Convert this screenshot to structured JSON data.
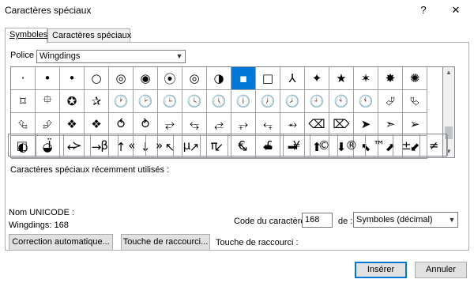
{
  "window": {
    "title": "Caractères spéciaux",
    "help_label": "?",
    "close_label": "✕"
  },
  "tabs": [
    {
      "label": "Symboles",
      "active": true
    },
    {
      "label": "Caractères spéciaux",
      "active": false
    }
  ],
  "font": {
    "label": "Police :",
    "value": "Wingdings"
  },
  "symbol_grid": {
    "rows": [
      [
        "·",
        "•",
        "•",
        "○",
        "◎",
        "◉",
        "⦿",
        "◎",
        "◑",
        "▪",
        "□",
        "⅄",
        "✦",
        "★",
        "✶",
        "✸",
        "✺",
        "❋",
        "⌖",
        "✧"
      ],
      [
        "⌑",
        "⯐",
        "✪",
        "✰",
        "🕐",
        "🕑",
        "🕒",
        "🕓",
        "🕔",
        "🕕",
        "🕖",
        "🕗",
        "🕘",
        "🕙",
        "🕚",
        "⮰",
        "⮱",
        "⮳",
        "⮲"
      ],
      [
        "⮴",
        "⮵",
        "❖",
        "❖",
        "⥀",
        "⥁",
        "⥂",
        "⥃",
        "⥄",
        "⥅",
        "⥆",
        "⥇",
        "⌫",
        "⌦",
        "➤",
        "➣",
        "➢",
        "⮘",
        "◓",
        "⯋"
      ],
      [
        "◐",
        "◒",
        "←",
        "→",
        "↑",
        "↓",
        "↖",
        "↗",
        "↙",
        "↘",
        "⬅",
        "➡",
        "⬆",
        "⬇",
        "⬉",
        "⬈",
        "⬋",
        "⬊",
        "⇦",
        "⇨",
        "⇧"
      ]
    ],
    "selected_row": 0,
    "selected_col": 9
  },
  "recent": {
    "label": "Caractères spéciaux récemment utilisés :",
    "symbols": [
      "□",
      "Ï",
      "≻",
      "β",
      "«",
      "»",
      "µ",
      "π",
      "€",
      "£",
      "¥",
      "©",
      "®",
      "™",
      "±",
      "≠",
      "≤",
      "≥",
      "÷",
      "×",
      "∞"
    ]
  },
  "unicode_name_label": "Nom UNICODE :",
  "info_text": "Wingdings: 168",
  "char_code": {
    "label": "Code du caractère :",
    "value": "168"
  },
  "from": {
    "label": "de :",
    "value": "Symboles (décimal)"
  },
  "buttons": {
    "autocorrect": "Correction automatique...",
    "shortcut_key": "Touche de raccourci...",
    "insert": "Insérer",
    "cancel": "Annuler"
  },
  "shortcut_text": "Touche de raccourci :"
}
